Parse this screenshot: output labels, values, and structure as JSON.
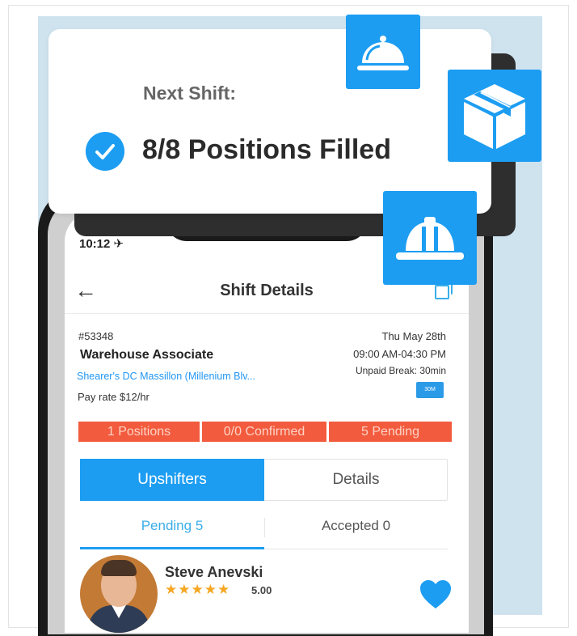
{
  "card": {
    "label": "Next Shift:",
    "value": "8/8 Positions Filled"
  },
  "icons": {
    "check": "check-circle-icon",
    "tile_1": "food-cloche-icon",
    "tile_2": "package-box-icon",
    "tile_3": "hard-hat-icon"
  },
  "status_bar": {
    "time": "10:12 ✈"
  },
  "nav": {
    "title": "Shift Details"
  },
  "job": {
    "id": "#53348",
    "title": "Warehouse Associate",
    "location": "Shearer's DC Massillon (Millenium Blv...",
    "pay_rate": "Pay rate $12/hr",
    "date": "Thu May 28th",
    "time": "09:00 AM-04:30 PM",
    "unpaid_break": "Unpaid Break:  30min",
    "badge": "30M"
  },
  "stats": {
    "positions": "1 Positions",
    "confirmed": "0/0 Confirmed",
    "pending": "5 Pending"
  },
  "tabs": {
    "upshifters": "Upshifters",
    "details": "Details"
  },
  "subtabs": {
    "pending": "Pending 5",
    "accepted": "Accepted 0"
  },
  "worker": {
    "name": "Steve Anevski",
    "stars": "★★★★★",
    "rating": "5.00"
  },
  "colors": {
    "accent": "#1c9df2",
    "stat_bar": "#f25b3d",
    "background_panel": "#cfe3ef",
    "star": "#f5a623"
  }
}
